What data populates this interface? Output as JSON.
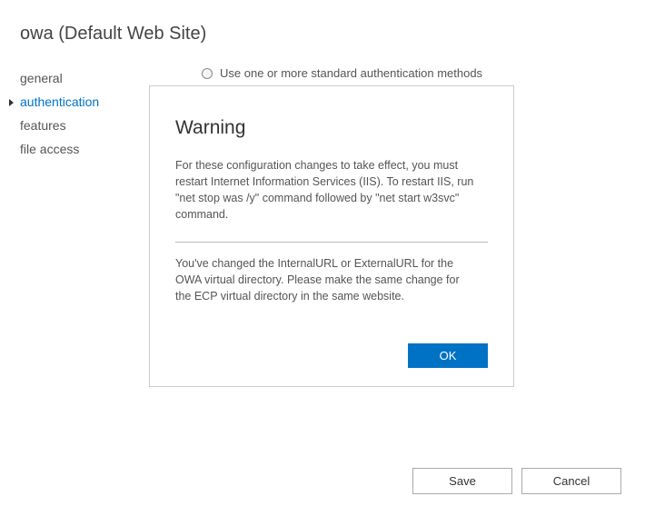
{
  "page": {
    "title": "owa (Default Web Site)"
  },
  "sidebar": {
    "items": [
      {
        "label": "general",
        "active": false
      },
      {
        "label": "authentication",
        "active": true
      },
      {
        "label": "features",
        "active": false
      },
      {
        "label": "file access",
        "active": false
      }
    ]
  },
  "main": {
    "auth_option_label": "Use one or more standard authentication methods"
  },
  "dialog": {
    "title": "Warning",
    "text1": "For these configuration changes to take effect, you must restart Internet Information Services (IIS). To restart IIS, run \"net stop was /y\" command followed by \"net start w3svc\" command.",
    "text2": "You've changed the InternalURL or ExternalURL for the OWA virtual directory. Please make the same change for the ECP virtual directory in the same website.",
    "ok_label": "OK"
  },
  "footer": {
    "save_label": "Save",
    "cancel_label": "Cancel"
  }
}
